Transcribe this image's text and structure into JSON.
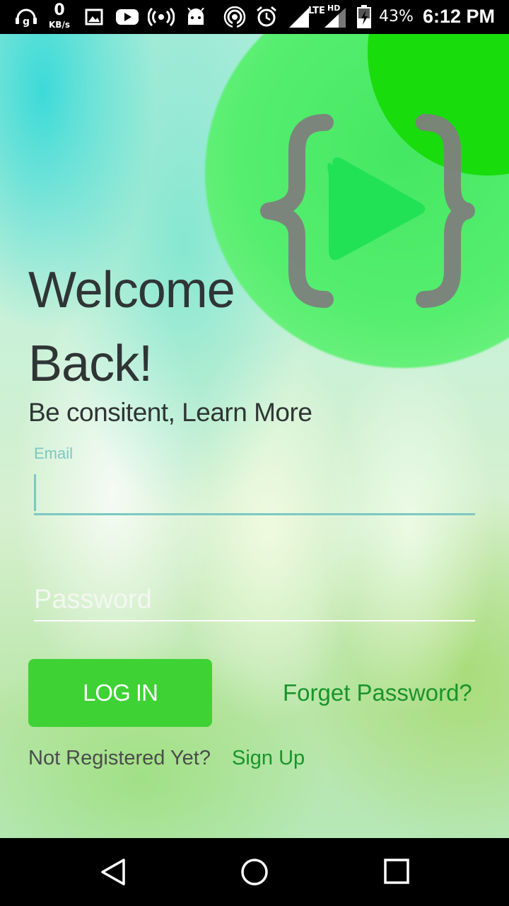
{
  "status_bar": {
    "speed_value": "0",
    "speed_unit": "KB/s",
    "network_label": "LTE",
    "network_hd": "HD",
    "battery": "43%",
    "time": "6:12 PM",
    "icons": [
      "headset-signal-icon",
      "gallery-icon",
      "youtube-icon",
      "hotspot-icon",
      "android-icon",
      "cast-icon",
      "alarm-icon",
      "signal-icon",
      "battery-icon"
    ]
  },
  "brand": {
    "logo": "code-play-logo-icon",
    "colors": {
      "primary": "#3fd235",
      "accent_dark": "#18942a",
      "teal": "#7cc8c3"
    }
  },
  "login": {
    "title_line1": "Welcome",
    "title_line2": "Back!",
    "subtitle": "Be consitent, Learn More",
    "email_label": "Email",
    "email_value": "",
    "password_placeholder": "Password",
    "login_button": "LOG IN",
    "forgot_password": "Forget Password?",
    "not_registered": "Not Registered Yet?",
    "sign_up": "Sign Up"
  },
  "nav_bar": {
    "buttons": [
      "back-icon",
      "home-icon",
      "recents-icon"
    ]
  }
}
